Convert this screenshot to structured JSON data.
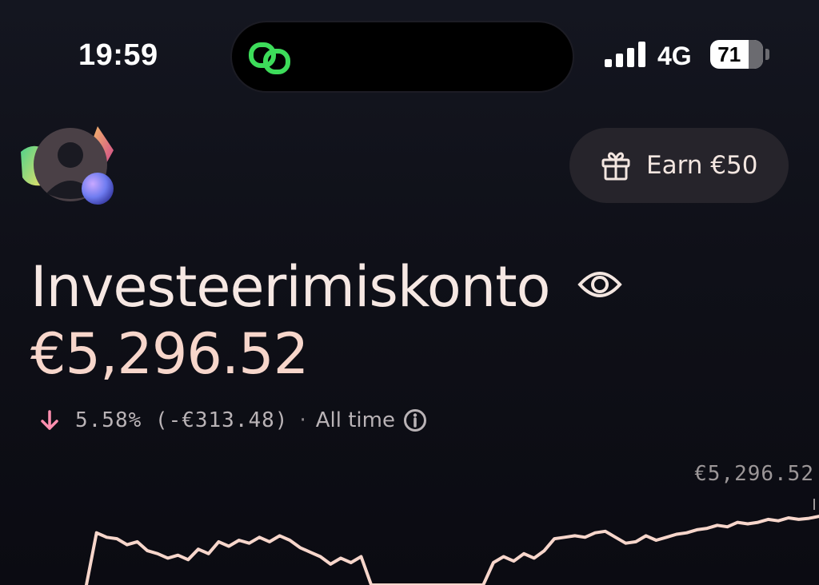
{
  "status_bar": {
    "time": "19:59",
    "network": "4G",
    "battery": "71",
    "icons": [
      "link-icon",
      "signal-icon",
      "battery-icon"
    ]
  },
  "header": {
    "earn_label": "Earn €50",
    "icons": [
      "avatar",
      "gift-icon"
    ]
  },
  "account": {
    "title": "Investeerimiskonto",
    "balance": "€5,296.52",
    "change_text": "5.58% (-€313.48)",
    "separator": "·",
    "period": "All time",
    "icons": [
      "eye-icon",
      "arrow-down-icon",
      "info-icon"
    ]
  },
  "colors": {
    "accent_line": "#f7d6cb",
    "negative": "#ff8fb0",
    "link_icon": "#3ddc5a",
    "button_bg": "#26242b"
  },
  "chart_data": {
    "type": "line",
    "current_value_label": "€5,296.52",
    "title": "",
    "xlabel": "",
    "ylabel": "",
    "ylim": [
      4850,
      5450
    ],
    "x": [
      0,
      1,
      2,
      3,
      4,
      5,
      6,
      7,
      8,
      9,
      10,
      11,
      12,
      13,
      14,
      15,
      16,
      17,
      18,
      19,
      20,
      21,
      22,
      23,
      24,
      25,
      26,
      27,
      28,
      29,
      30,
      31,
      32,
      33,
      34,
      35,
      36,
      37,
      38,
      39,
      40,
      41,
      42,
      43,
      44,
      45,
      46,
      47,
      48,
      49,
      50,
      51,
      52,
      53,
      54,
      55,
      56,
      57,
      58,
      59,
      60,
      61,
      62,
      63,
      64,
      65,
      66,
      67,
      68,
      69,
      70,
      71,
      72
    ],
    "series": [
      {
        "values": [
          4850,
          5200,
          5170,
          5160,
          5120,
          5140,
          5080,
          5060,
          5030,
          5050,
          5020,
          5090,
          5060,
          5140,
          5110,
          5150,
          5130,
          5170,
          5140,
          5180,
          5150,
          5100,
          5070,
          5040,
          4990,
          5030,
          5000,
          5040,
          4850,
          4850,
          4850,
          4850,
          4850,
          4850,
          4850,
          4850,
          4850,
          4850,
          4850,
          4850,
          5000,
          5040,
          5010,
          5060,
          5030,
          5080,
          5160,
          5170,
          5180,
          5170,
          5200,
          5210,
          5170,
          5130,
          5140,
          5180,
          5150,
          5170,
          5190,
          5200,
          5220,
          5230,
          5250,
          5240,
          5270,
          5260,
          5270,
          5290,
          5280,
          5300,
          5290,
          5296.52,
          5310
        ]
      }
    ]
  }
}
